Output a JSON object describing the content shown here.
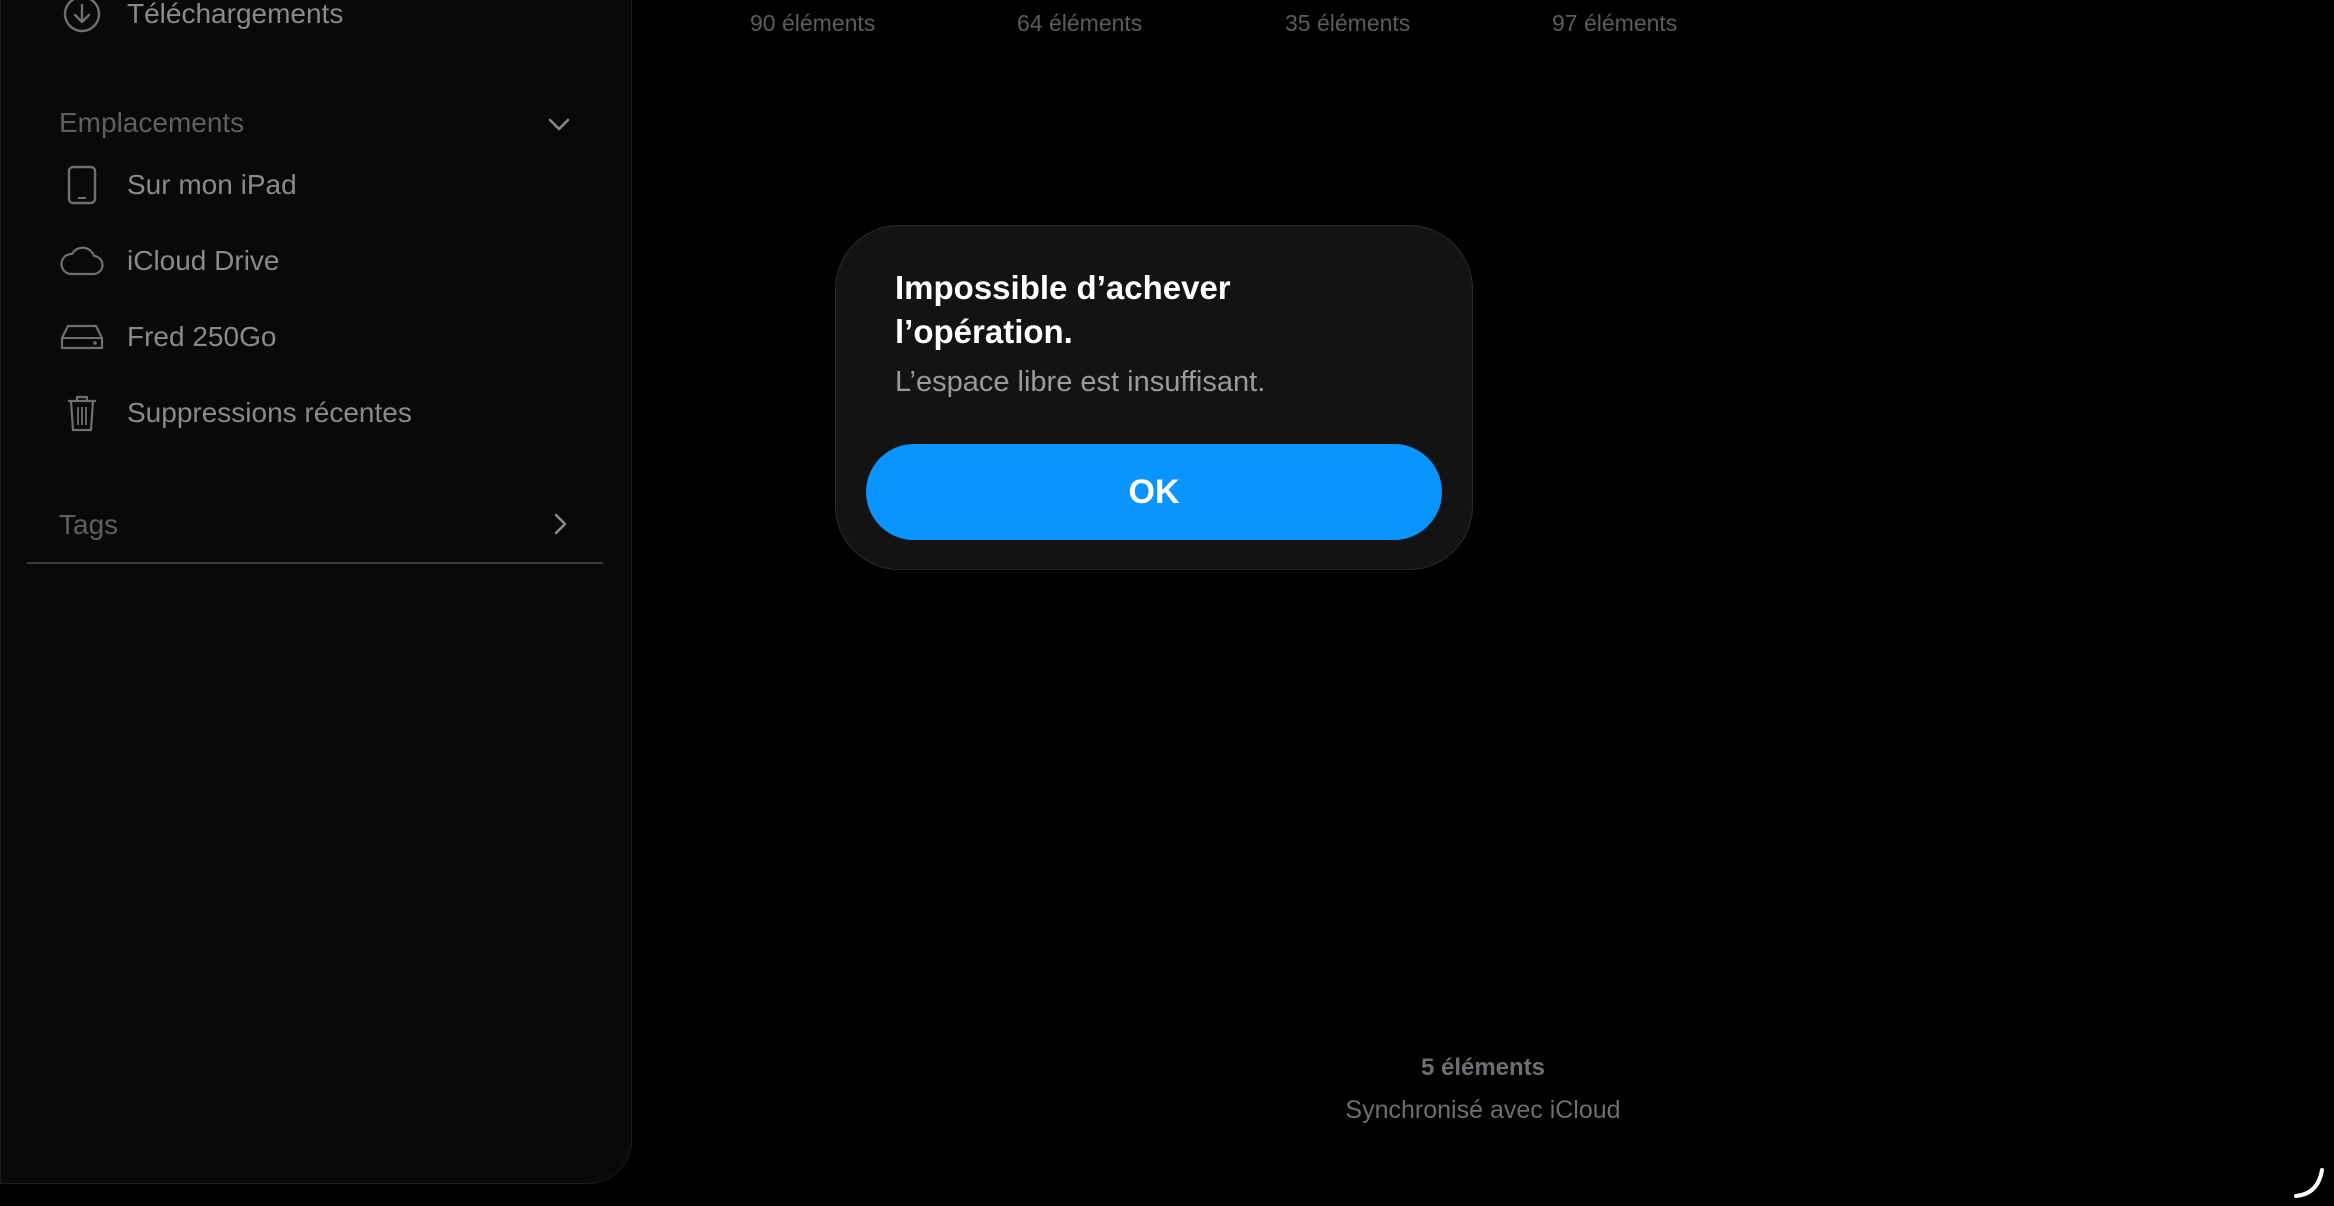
{
  "sidebar": {
    "downloads_label": "Téléchargements",
    "locations_header": "Emplacements",
    "locations": [
      {
        "label": "Sur mon iPad",
        "icon": "ipad-icon"
      },
      {
        "label": "iCloud Drive",
        "icon": "cloud-icon"
      },
      {
        "label": "Fred 250Go",
        "icon": "external-drive-icon"
      },
      {
        "label": "Suppressions récentes",
        "icon": "trash-icon"
      }
    ],
    "tags_header": "Tags"
  },
  "grid": {
    "counts": [
      "90 éléments",
      "64 éléments",
      "35 éléments",
      "97 éléments"
    ]
  },
  "footer": {
    "item_count": "5 éléments",
    "sync_status": "Synchronisé avec iCloud"
  },
  "alert": {
    "title": "Impossible d’achever l’opération.",
    "message": "L’espace libre est insuffisant.",
    "ok_label": "OK",
    "button_color": "#0a94ff"
  }
}
